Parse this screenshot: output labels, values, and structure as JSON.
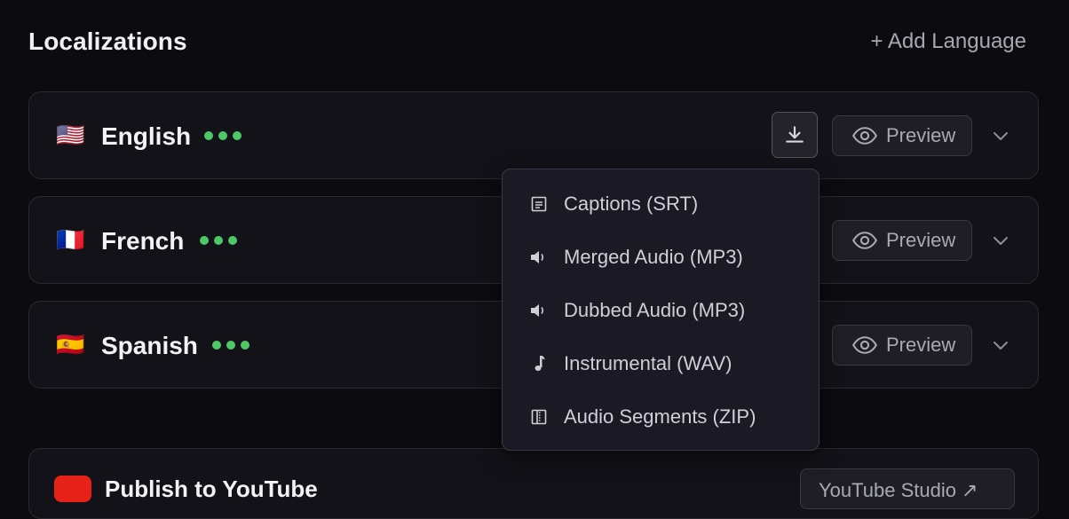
{
  "header": {
    "title": "Localizations",
    "add_language": "+ Add Language"
  },
  "languages": [
    {
      "name": "English",
      "flag": "🇺🇸",
      "preview_label": "Preview"
    },
    {
      "name": "French",
      "flag": "🇫🇷",
      "preview_label": "Preview"
    },
    {
      "name": "Spanish",
      "flag": "🇪🇸",
      "preview_label": "Preview"
    }
  ],
  "download_menu": {
    "items": [
      {
        "label": "Captions (SRT)",
        "icon": "captions-icon"
      },
      {
        "label": "Merged Audio (MP3)",
        "icon": "speaker-icon"
      },
      {
        "label": "Dubbed Audio (MP3)",
        "icon": "speaker-icon"
      },
      {
        "label": "Instrumental (WAV)",
        "icon": "music-note-icon"
      },
      {
        "label": "Audio Segments (ZIP)",
        "icon": "archive-icon"
      }
    ]
  },
  "publish": {
    "title": "Publish to YouTube",
    "studio_label": "YouTube Studio ↗"
  },
  "colors": {
    "status_dot": "#4ec866",
    "background": "#0c0b10",
    "youtube_red": "#e62117"
  }
}
